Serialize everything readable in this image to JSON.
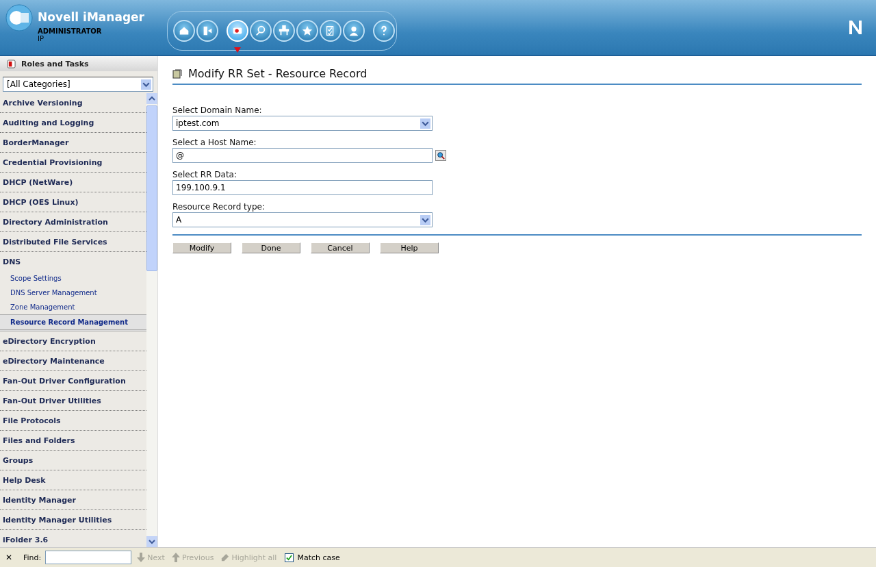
{
  "header": {
    "title": "Novell iManager",
    "user": "ADMINISTRATOR",
    "tree": "IP"
  },
  "toolbar": [
    {
      "kind": "home",
      "selected": false
    },
    {
      "kind": "exit",
      "selected": false
    },
    {
      "kind": "roles",
      "selected": true
    },
    {
      "kind": "view",
      "selected": false
    },
    {
      "kind": "config",
      "selected": false
    },
    {
      "kind": "favorites",
      "selected": false
    },
    {
      "kind": "tasks",
      "selected": false
    },
    {
      "kind": "user",
      "selected": false
    },
    {
      "kind": "help",
      "selected": false
    }
  ],
  "sidebar": {
    "title": "Roles and Tasks",
    "category": "[All Categories]",
    "items": [
      {
        "label": "Archive Versioning",
        "expanded": false
      },
      {
        "label": "Auditing and Logging",
        "expanded": false
      },
      {
        "label": "BorderManager",
        "expanded": false
      },
      {
        "label": "Credential Provisioning",
        "expanded": false
      },
      {
        "label": "DHCP (NetWare)",
        "expanded": false
      },
      {
        "label": "DHCP (OES Linux)",
        "expanded": false
      },
      {
        "label": "Directory Administration",
        "expanded": false
      },
      {
        "label": "Distributed File Services",
        "expanded": false
      },
      {
        "label": "DNS",
        "expanded": true,
        "children": [
          {
            "label": "Scope Settings",
            "selected": false
          },
          {
            "label": "DNS Server Management",
            "selected": false
          },
          {
            "label": "Zone Management",
            "selected": false
          },
          {
            "label": "Resource Record Management",
            "selected": true
          }
        ]
      },
      {
        "label": "eDirectory Encryption",
        "expanded": false
      },
      {
        "label": "eDirectory Maintenance",
        "expanded": false
      },
      {
        "label": "Fan-Out Driver Configuration",
        "expanded": false
      },
      {
        "label": "Fan-Out Driver Utilities",
        "expanded": false
      },
      {
        "label": "File Protocols",
        "expanded": false
      },
      {
        "label": "Files and Folders",
        "expanded": false
      },
      {
        "label": "Groups",
        "expanded": false
      },
      {
        "label": "Help Desk",
        "expanded": false
      },
      {
        "label": "Identity Manager",
        "expanded": false
      },
      {
        "label": "Identity Manager Utilities",
        "expanded": false
      },
      {
        "label": "iFolder 3.6",
        "expanded": false
      }
    ]
  },
  "page": {
    "title": "Modify RR Set - Resource Record",
    "fields": [
      {
        "kind": "select",
        "label": "Select Domain Name:",
        "value": "iptest.com"
      },
      {
        "kind": "browse",
        "label": "Select a Host Name:",
        "value": "@"
      },
      {
        "kind": "text",
        "label": "Select RR Data:",
        "value": "199.100.9.1"
      },
      {
        "kind": "select",
        "label": "Resource Record type:",
        "value": "A"
      }
    ],
    "buttons": [
      "Modify",
      "Done",
      "Cancel",
      "Help"
    ]
  },
  "find_bar": {
    "close": "✕",
    "label": "Find:",
    "next": {
      "label": "Next",
      "disabled": true
    },
    "previous": {
      "label": "Previous",
      "disabled": true
    },
    "highlight": {
      "label": "Highlight all",
      "disabled": true
    },
    "match_case": {
      "label": "Match case",
      "checked": true
    }
  }
}
